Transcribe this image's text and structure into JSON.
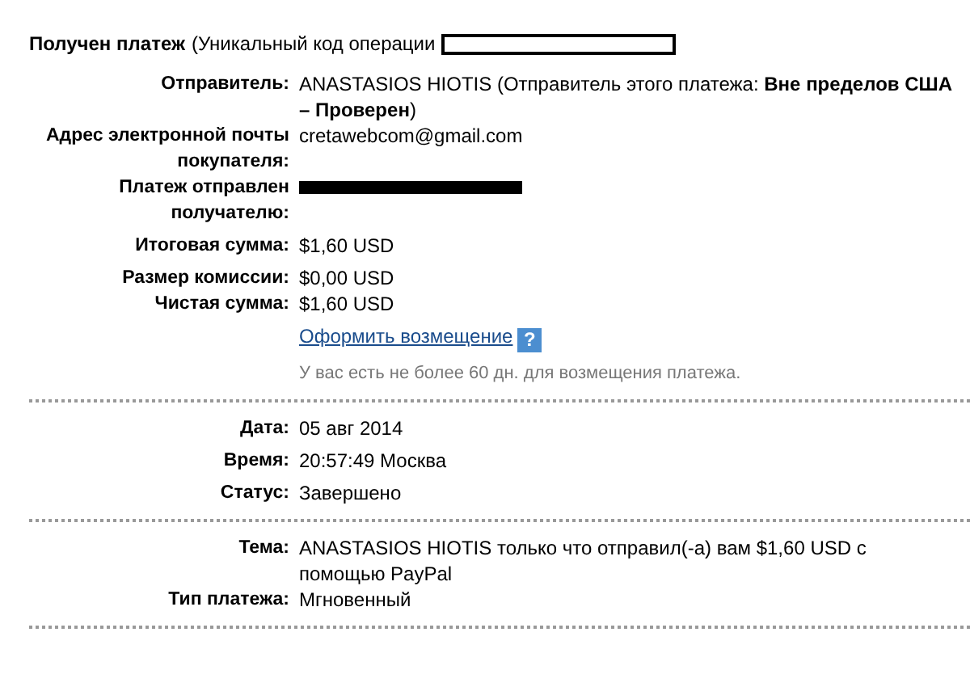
{
  "header": {
    "title": "Получен платеж",
    "detail": "(Уникальный код операции"
  },
  "sections": [
    {
      "groups": [
        [
          {
            "kind": "text",
            "label": "Отправитель:",
            "value": "ANASTASIOS HIOTIS (Отправитель этого платежа: **Вне пределов США – Проверен**)"
          },
          {
            "kind": "text",
            "label": "Адрес электронной почты покупателя:",
            "value": "cretawebcom@gmail.com"
          },
          {
            "kind": "redacted",
            "label": "Платеж отправлен получателю:"
          }
        ],
        [
          {
            "kind": "text",
            "label": "Итоговая сумма:",
            "value": "$1,60 USD"
          }
        ],
        [
          {
            "kind": "text",
            "label": "Размер комиссии:",
            "value": "$0,00 USD"
          },
          {
            "kind": "text",
            "label": "Чистая сумма:",
            "value": "$1,60 USD"
          }
        ],
        [
          {
            "kind": "link",
            "value": "Оформить возмещение",
            "help": "?"
          }
        ],
        [
          {
            "kind": "note",
            "value": "У вас есть не более 60 дн. для возмещения платежа."
          }
        ]
      ]
    },
    {
      "groups": [
        [
          {
            "kind": "text",
            "label": "Дата:",
            "value": "05 авг 2014"
          }
        ],
        [
          {
            "kind": "text",
            "label": "Время:",
            "value": "20:57:49 Москва"
          }
        ],
        [
          {
            "kind": "text",
            "label": "Статус:",
            "value": "Завершено"
          }
        ]
      ]
    },
    {
      "groups": [
        [
          {
            "kind": "text",
            "label": "Тема:",
            "value": "ANASTASIOS HIOTIS только что отправил(-а) вам $1,60 USD с помощью PayPal"
          },
          {
            "kind": "text",
            "label": "Тип платежа:",
            "value": "Мгновенный"
          }
        ]
      ]
    }
  ]
}
